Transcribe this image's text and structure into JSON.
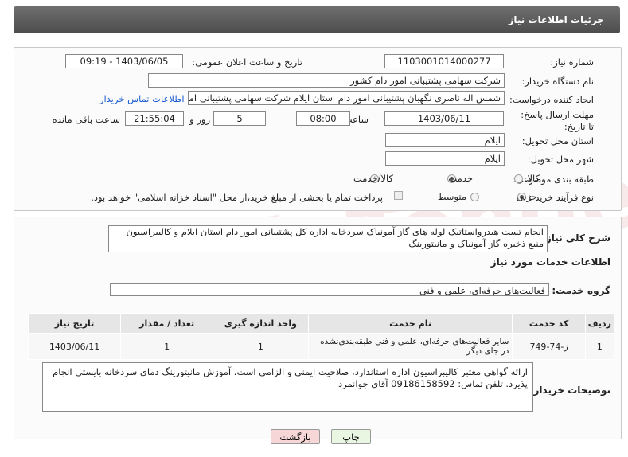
{
  "header": {
    "title": "جزئیات اطلاعات نیاز"
  },
  "watermark": {
    "text": "AriaTender.neT"
  },
  "form": {
    "need_number_label": "شماره نیاز:",
    "need_number": "1103001014000277",
    "announce_label": "تاریخ و ساعت اعلان عمومی:",
    "announce_value": "1403/06/05 - 09:19",
    "buyer_org_label": "نام دستگاه خریدار:",
    "buyer_org": "شرکت سهامی پشتیبانی امور دام کشور",
    "creator_label": "ایجاد کننده درخواست:",
    "creator": "شمس اله ناصری نگهبان پشتیبانی امور دام استان ایلام شرکت سهامی پشتیبانی امور دام کشور",
    "contact_link": "اطلاعات تماس خریدار",
    "deadline_label": "مهلت ارسال پاسخ: تا تاریخ:",
    "deadline_date": "1403/06/11",
    "time_label": "ساعت",
    "deadline_time": "08:00",
    "days_value": "5",
    "days_label": "روز و",
    "remaining_time": "21:55:04",
    "remaining_label": "ساعت باقی مانده",
    "province_label": "استان محل تحویل:",
    "province": "ایلام",
    "city_label": "شهر محل تحویل:",
    "city": "ایلام",
    "category_label": "طبقه بندی موضوعی:",
    "category_options": [
      "کالا",
      "خدمت",
      "کالا/خدمت"
    ],
    "process_label": "نوع فرآیند خرید :",
    "process_options": [
      "جزیی",
      "متوسط"
    ],
    "treasury_text": "پرداخت تمام یا بخشی از مبلغ خرید،از محل \"اسناد خزانه اسلامی\" خواهد بود."
  },
  "summary": {
    "label": "شرح کلی نیاز:",
    "text": "انجام تست هیدرواستاتیک لوله های گاز آمونیاک سردخانه اداره کل پشتیبانی امور دام استان ایلام و کالیبراسیون منبع ذخیره گاز آمونیاک و مانیتورینگ"
  },
  "services": {
    "heading": "اطلاعات خدمات مورد نیاز",
    "group_label": "گروه خدمت:",
    "group_value": "فعالیت‌های حرفه‌ای، علمی و فنی"
  },
  "table": {
    "columns": [
      "ردیف",
      "کد خدمت",
      "نام خدمت",
      "واحد اندازه گیری",
      "تعداد / مقدار",
      "تاریخ نیاز"
    ],
    "rows": [
      [
        "1",
        "ز-74-749",
        "سایر فعالیت‌های حرفه‌ای، علمی و فنی طبقه‌بندی‌نشده در جای دیگر",
        "1",
        "1",
        "1403/06/11"
      ]
    ]
  },
  "buyer_notes": {
    "label": "توضیحات خریدار:",
    "text": "ارائه گواهی معتبر کالیبراسیون اداره استاندارد، صلاحیت ایمنی و الزامی است. آموزش مانیتورینگ دمای سردخانه بایستی انجام پذیرد. تلفن تماس: 09186158592 آقای جوانمرد"
  },
  "buttons": {
    "print": "چاپ",
    "back": "بازگشت"
  },
  "colors": {
    "header_bg": "#5a5a5a",
    "link": "#1a5bd1",
    "back_btn": "#f6d6d6",
    "print_btn": "#e9f6e2"
  }
}
